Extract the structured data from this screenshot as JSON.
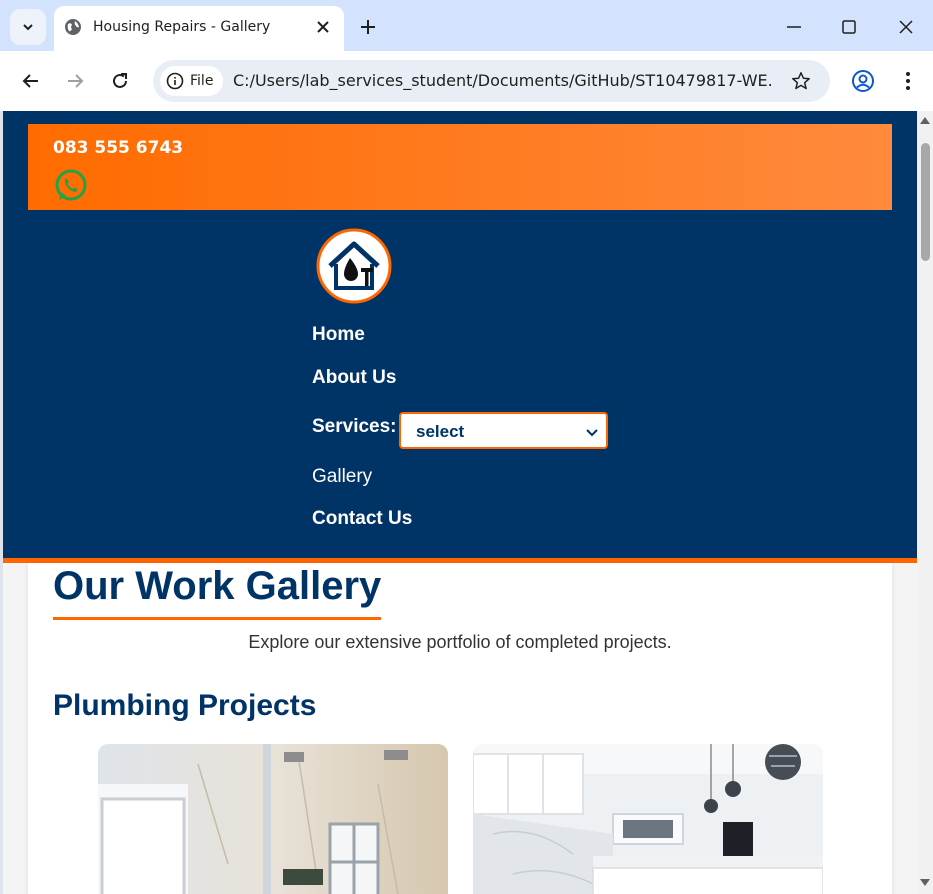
{
  "browser": {
    "tab_title": "Housing Repairs - Gallery",
    "site_chip": "File",
    "url": "C:/Users/lab_services_student/Documents/GitHub/ST10479817-WE..."
  },
  "header": {
    "phone": "083 555 6743",
    "nav": {
      "home": "Home",
      "about": "About Us",
      "services_label": "Services:",
      "services_selected": "select",
      "gallery": "Gallery",
      "contact": "Contact Us"
    }
  },
  "main": {
    "title": "Our Work Gallery",
    "intro": "Explore our extensive portfolio of completed projects.",
    "section_title": "Plumbing Projects"
  },
  "colors": {
    "navy": "#003366",
    "orange": "#ff6600",
    "whatsapp_green": "#25a244"
  },
  "icons": [
    "tab-search-icon",
    "globe-icon",
    "close-icon",
    "new-tab-icon",
    "minimize-icon",
    "maximize-icon",
    "back-icon",
    "forward-icon",
    "reload-icon",
    "info-icon",
    "star-icon",
    "profile-icon",
    "menu-icon",
    "whatsapp-icon",
    "logo-icon",
    "chevron-down-icon"
  ]
}
